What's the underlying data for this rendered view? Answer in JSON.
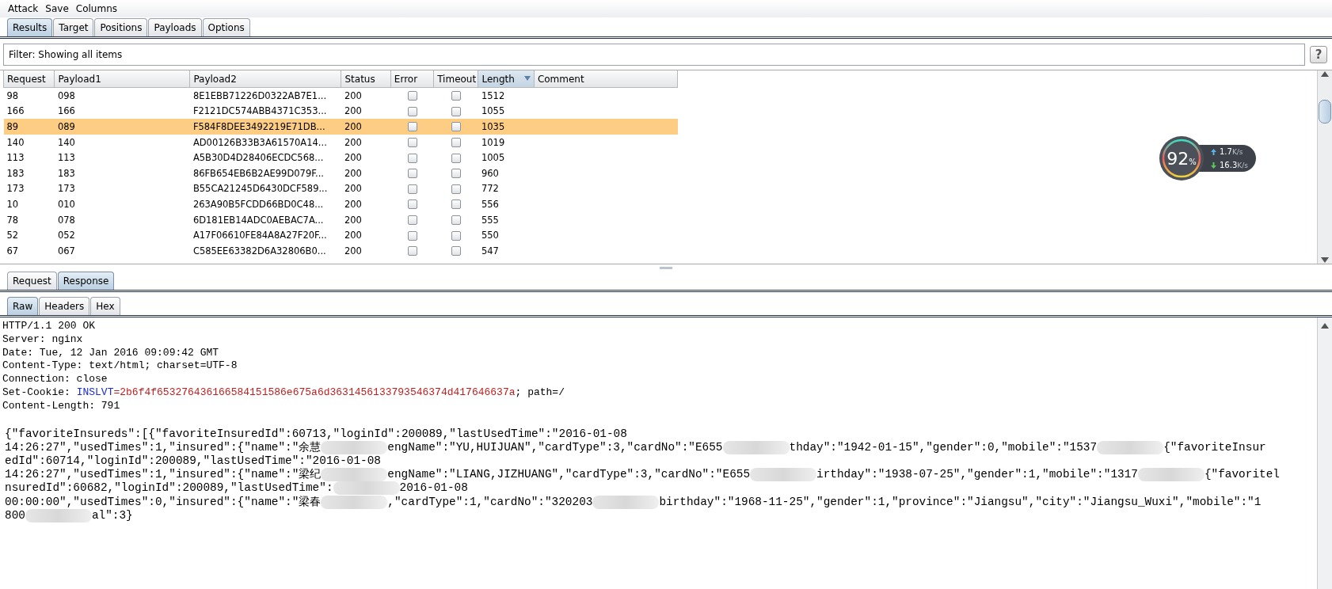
{
  "menu": [
    "Attack",
    "Save",
    "Columns"
  ],
  "tabs": [
    {
      "label": "Results",
      "selected": true
    },
    {
      "label": "Target",
      "selected": false
    },
    {
      "label": "Positions",
      "selected": false
    },
    {
      "label": "Payloads",
      "selected": false
    },
    {
      "label": "Options",
      "selected": false
    }
  ],
  "filter": {
    "label": "Filter: Showing all items",
    "help": "?"
  },
  "table": {
    "columns": [
      {
        "label": "Request",
        "sorted": false
      },
      {
        "label": "Payload1",
        "sorted": false
      },
      {
        "label": "Payload2",
        "sorted": false
      },
      {
        "label": "Status",
        "sorted": false
      },
      {
        "label": "Error",
        "sorted": false
      },
      {
        "label": "Timeout",
        "sorted": false
      },
      {
        "label": "Length",
        "sorted": true
      },
      {
        "label": "Comment",
        "sorted": false
      }
    ],
    "rows": [
      {
        "request": "98",
        "payload1": "098",
        "payload2": "8E1EBB71226D0322AB7E1...",
        "status": "200",
        "error": false,
        "timeout": false,
        "length": "1512",
        "selected": false
      },
      {
        "request": "166",
        "payload1": "166",
        "payload2": "F2121DC574ABB4371C353...",
        "status": "200",
        "error": false,
        "timeout": false,
        "length": "1055",
        "selected": false
      },
      {
        "request": "89",
        "payload1": "089",
        "payload2": "F584F8DEE3492219E71DB...",
        "status": "200",
        "error": false,
        "timeout": false,
        "length": "1035",
        "selected": true
      },
      {
        "request": "140",
        "payload1": "140",
        "payload2": "AD00126B33B3A61570A14...",
        "status": "200",
        "error": false,
        "timeout": false,
        "length": "1019",
        "selected": false
      },
      {
        "request": "113",
        "payload1": "113",
        "payload2": "A5B30D4D28406ECDC568...",
        "status": "200",
        "error": false,
        "timeout": false,
        "length": "1005",
        "selected": false
      },
      {
        "request": "183",
        "payload1": "183",
        "payload2": "86FB654EB6B2AE99D079F...",
        "status": "200",
        "error": false,
        "timeout": false,
        "length": "960",
        "selected": false
      },
      {
        "request": "173",
        "payload1": "173",
        "payload2": "B55CA21245D6430DCF589...",
        "status": "200",
        "error": false,
        "timeout": false,
        "length": "772",
        "selected": false
      },
      {
        "request": "10",
        "payload1": "010",
        "payload2": "263A90B5FCDD66BD0C48...",
        "status": "200",
        "error": false,
        "timeout": false,
        "length": "556",
        "selected": false
      },
      {
        "request": "78",
        "payload1": "078",
        "payload2": "6D181EB14ADC0AEBAC7A...",
        "status": "200",
        "error": false,
        "timeout": false,
        "length": "555",
        "selected": false
      },
      {
        "request": "52",
        "payload1": "052",
        "payload2": "A17F06610FE84A8A27F20F...",
        "status": "200",
        "error": false,
        "timeout": false,
        "length": "550",
        "selected": false
      },
      {
        "request": "67",
        "payload1": "067",
        "payload2": "C585EE63382D6A32806B0...",
        "status": "200",
        "error": false,
        "timeout": false,
        "length": "547",
        "selected": false
      }
    ]
  },
  "net_monitor": {
    "percent": "92",
    "unit": "%",
    "upload": "1.7",
    "upload_unit": "K/s",
    "download": "16.3",
    "download_unit": "K/s"
  },
  "message_tabs": [
    {
      "label": "Request",
      "selected": false
    },
    {
      "label": "Response",
      "selected": true
    }
  ],
  "view_tabs": [
    {
      "label": "Raw",
      "selected": true
    },
    {
      "label": "Headers",
      "selected": false
    },
    {
      "label": "Hex",
      "selected": false
    }
  ],
  "response": {
    "headers": [
      [
        {
          "kind": "plain",
          "text": "HTTP/1.1 200 OK"
        }
      ],
      [
        {
          "kind": "plain",
          "text": "Server: nginx"
        }
      ],
      [
        {
          "kind": "plain",
          "text": "Date: Tue, 12 Jan 2016 09:09:42 GMT"
        }
      ],
      [
        {
          "kind": "plain",
          "text": "Content-Type: text/html; charset=UTF-8"
        }
      ],
      [
        {
          "kind": "plain",
          "text": "Connection: close"
        }
      ],
      [
        {
          "kind": "plain",
          "text": "Set-Cookie: "
        },
        {
          "kind": "cookie_name",
          "text": "INSLVT"
        },
        {
          "kind": "cookie_value",
          "text": "=2b6f4f653276436166584151586e675a6d3631456133793546374d417646637a"
        },
        {
          "kind": "plain",
          "text": "; path=/"
        }
      ],
      [
        {
          "kind": "plain",
          "text": "Content-Length: 791"
        }
      ]
    ],
    "body": [
      [
        {
          "kind": "text",
          "text": "{\"favoriteInsureds\":[{\"favoriteInsuredId\":60713,\"loginId\":200089,\"lastUsedTime\":\"2016-01-08"
        }
      ],
      [
        {
          "kind": "text",
          "text": "14:26:27\",\"usedTimes\":1,\"insured\":{\"name\":\"余慧"
        },
        {
          "kind": "redacted"
        },
        {
          "kind": "text",
          "text": "engName\":\"YU,HUIJUAN\",\"cardType\":3,\"cardNo\":\"E655"
        },
        {
          "kind": "redacted"
        },
        {
          "kind": "text",
          "text": "thday\":\"1942-01-15\",\"gender\":0,\"mobile\":\"1537"
        },
        {
          "kind": "redacted"
        },
        {
          "kind": "text",
          "text": "{\"favoriteInsur"
        }
      ],
      [
        {
          "kind": "text",
          "text": "edId\":60714,\"loginId\":200089,\"lastUsedTime\":\"2016-01-08"
        }
      ],
      [
        {
          "kind": "text",
          "text": "14:26:27\",\"usedTimes\":1,\"insured\":{\"name\":\"梁纪"
        },
        {
          "kind": "redacted"
        },
        {
          "kind": "text",
          "text": "engName\":\"LIANG,JIZHUANG\",\"cardType\":3,\"cardNo\":\"E655"
        },
        {
          "kind": "redacted"
        },
        {
          "kind": "text",
          "text": "irthday\":\"1938-07-25\",\"gender\":1,\"mobile\":\"1317"
        },
        {
          "kind": "redacted"
        },
        {
          "kind": "text",
          "text": "{\"favoritel"
        }
      ],
      [
        {
          "kind": "text",
          "text": "nsuredId\":60682,\"loginId\":200089,\"lastUsedTime\":"
        },
        {
          "kind": "redacted"
        },
        {
          "kind": "text",
          "text": "2016-01-08"
        }
      ],
      [
        {
          "kind": "text",
          "text": "00:00:00\",\"usedTimes\":0,\"insured\":{\"name\":\"梁春"
        },
        {
          "kind": "redacted"
        },
        {
          "kind": "text",
          "text": ",\"cardType\":1,\"cardNo\":\"320203"
        },
        {
          "kind": "redacted"
        },
        {
          "kind": "text",
          "text": "birthday\":\"1968-11-25\",\"gender\":1,\"province\":\"Jiangsu\",\"city\":\"Jiangsu_Wuxi\",\"mobile\":\"1"
        }
      ],
      [
        {
          "kind": "text",
          "text": "800"
        },
        {
          "kind": "redacted"
        },
        {
          "kind": "text",
          "text": "al\":3}"
        }
      ]
    ]
  }
}
